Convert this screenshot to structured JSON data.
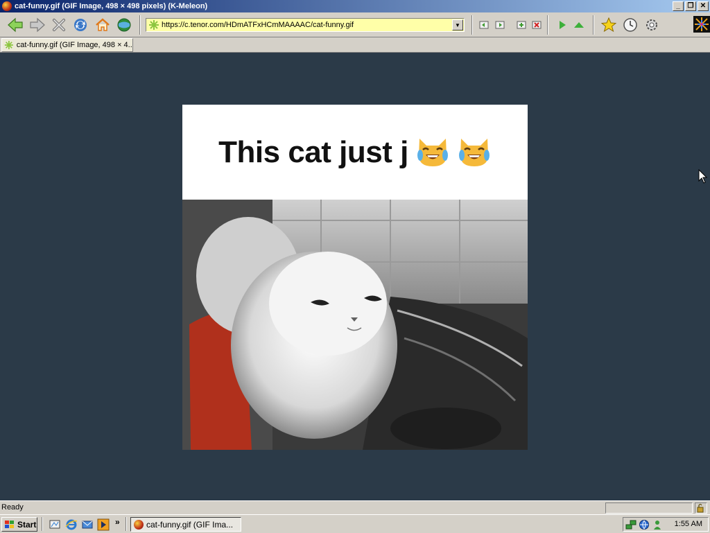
{
  "window": {
    "title": "cat-funny.gif (GIF Image, 498 × 498 pixels) (K-Meleon)",
    "min_label": "_",
    "restore_label": "❐",
    "close_label": "✕"
  },
  "toolbar": {
    "url": "https://c.tenor.com/HDmATFxHCmMAAAAC/cat-funny.gif",
    "dropdown_glyph": "▼"
  },
  "tab": {
    "label": "cat-funny.gif (GIF Image, 498 × 4..."
  },
  "image": {
    "caption": "This cat just j",
    "emoji": "crying-laughing-cat"
  },
  "status": {
    "text": "Ready"
  },
  "taskbar": {
    "start_label": "Start",
    "chevron": "»",
    "task_label": "cat-funny.gif (GIF Ima...",
    "clock": "1:55 AM"
  },
  "colors": {
    "content_bg": "#2b3a48",
    "url_bg": "#ffffa8",
    "title_bar": "#0a246a"
  }
}
